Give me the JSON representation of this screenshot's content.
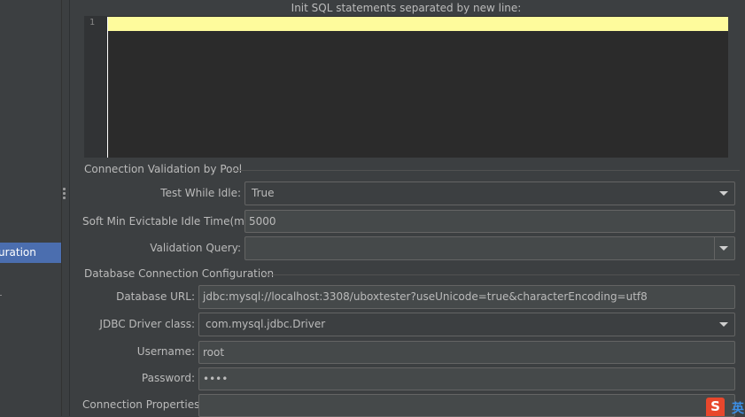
{
  "sidebar": {
    "selected_item": "uration"
  },
  "editor": {
    "title": "Init SQL statements separated by new line:",
    "line_number": "1"
  },
  "validation_section": {
    "title": "Connection Validation by Pool",
    "test_while_idle": {
      "label": "Test While Idle:",
      "value": "True"
    },
    "soft_min_evictable": {
      "label": "Soft Min Evictable Idle Time(ms):",
      "value": "5000"
    },
    "validation_query": {
      "label": "Validation Query:",
      "value": ""
    }
  },
  "db_section": {
    "title": "Database Connection Configuration",
    "database_url": {
      "label": "Database URL:",
      "value": "jdbc:mysql://localhost:3308/uboxtester?useUnicode=true&characterEncoding=utf8"
    },
    "jdbc_driver": {
      "label": "JDBC Driver class:",
      "value": "com.mysql.jdbc.Driver"
    },
    "username": {
      "label": "Username:",
      "value": "root"
    },
    "password": {
      "label": "Password:",
      "value": "••••"
    },
    "connection_properties": {
      "label": "Connection Properties:",
      "value": ""
    }
  },
  "ime": {
    "logo": "S",
    "mode": "英"
  },
  "colors": {
    "selection": "#4b6eaf",
    "caret_line": "#fefb9c",
    "background": "#3c3f41"
  }
}
